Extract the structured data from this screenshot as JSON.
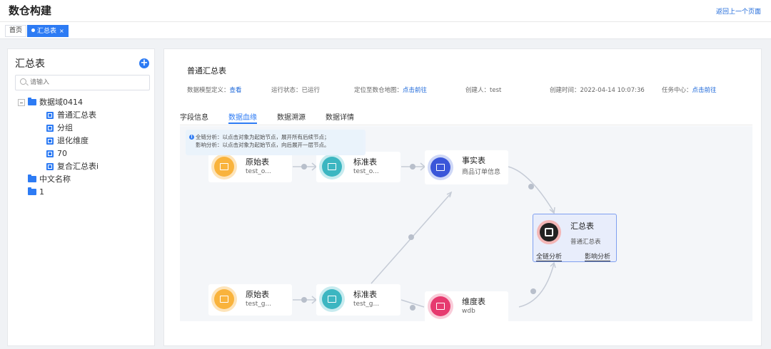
{
  "header": {
    "title": "数仓构建",
    "back_label": "返回上一个页面"
  },
  "tabs": {
    "home": "首页",
    "active": "汇总表",
    "close": "×"
  },
  "sidebar": {
    "title": "汇总表",
    "add": "+",
    "search_placeholder": "请输入",
    "tree": {
      "root": "数据域0414",
      "children": [
        "普通汇总表",
        "分组",
        "退化维度",
        "70",
        "复合汇总表i"
      ],
      "folders": [
        "中文名称",
        "1"
      ]
    }
  },
  "main": {
    "title": "普通汇总表",
    "info": {
      "model_label": "数据模型定义：",
      "model_link": "查看",
      "status_label": "运行状态：",
      "status_value": "已运行",
      "locate_label": "定位至数仓地图：",
      "locate_link": "点击前往",
      "creator_label": "创建人：",
      "creator_value": "test",
      "created_label": "创建时间：",
      "created_value": "2022-04-14 10:07:36",
      "task_label": "任务中心：",
      "task_link": "点击前往"
    },
    "tabs": [
      "字段信息",
      "数据血缘",
      "数据溯源",
      "数据详情"
    ],
    "active_tab": "数据血缘"
  },
  "lineage": {
    "tip_line1": "全链分析：以点击对象为起始节点，展开所有后续节点；",
    "tip_line2": "影响分析：以点击对象为起始节点，向后展开一层节点。",
    "nodes": {
      "raw1": {
        "name": "原始表",
        "sub": "test_o..."
      },
      "std1": {
        "name": "标准表",
        "sub": "test_o..."
      },
      "fact": {
        "name": "事实表",
        "sub": "商品订单信息"
      },
      "raw2": {
        "name": "原始表",
        "sub": "test_g..."
      },
      "std2": {
        "name": "标准表",
        "sub": "test_g..."
      },
      "dim": {
        "name": "维度表",
        "sub": "wdb"
      },
      "summary": {
        "name": "汇总表",
        "sub": "普通汇总表",
        "action_full": "全链分析",
        "action_impact": "影响分析"
      }
    },
    "colors": {
      "raw": "#f9b33c",
      "std": "#3cb6c1",
      "fact": "#3a56d9",
      "dim": "#e63a6f",
      "accent": "#2d7bf4"
    }
  }
}
